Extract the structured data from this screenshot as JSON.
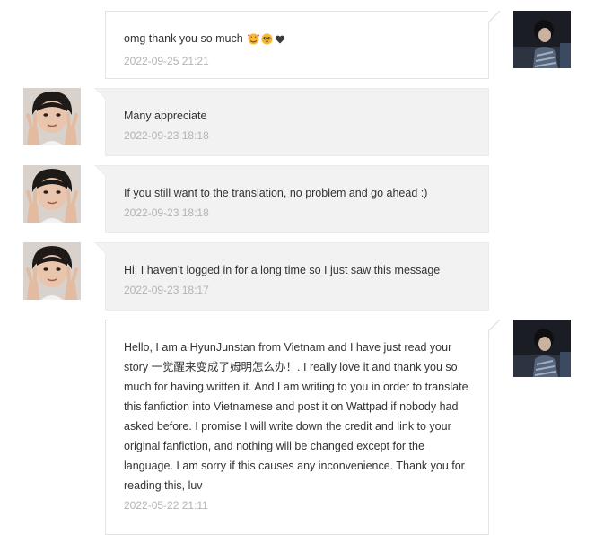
{
  "messages": [
    {
      "side": "self",
      "text": "omg thank you so much",
      "emojis": [
        "smiling-face-with-hearts-icon",
        "pleading-face-icon",
        "black-heart-icon"
      ],
      "time": "2022-09-25 21:21"
    },
    {
      "side": "other",
      "text": "Many appreciate",
      "time": "2022-09-23 18:18"
    },
    {
      "side": "other",
      "text": "If you still want to the translation, no problem and go ahead :)",
      "time": "2022-09-23 18:18"
    },
    {
      "side": "other",
      "text": "Hi! I haven’t logged in for a long time so I just saw this message",
      "time": "2022-09-23 18:17"
    },
    {
      "side": "self",
      "text": "Hello, I am a HyunJunstan from Vietnam and I have just read your story 一觉醒来变成了姆明怎么办！. I really love it and thank you so much for having written it. And I am writing to you in order to translate this fanfiction into Vietnamese and post it on Wattpad if nobody had asked before. I promise I will write down the credit and link to your original fanfiction, and nothing will be changed except for the language. I am sorry if this causes any inconvenience. Thank you for reading this, luv",
      "time": "2022-05-22 21:11"
    }
  ],
  "colors": {
    "self_bubble": "#ffffff",
    "other_bubble": "#f2f2f2",
    "border": "#e3e3e3",
    "timestamp": "#b3b3b3",
    "text": "#333333"
  }
}
